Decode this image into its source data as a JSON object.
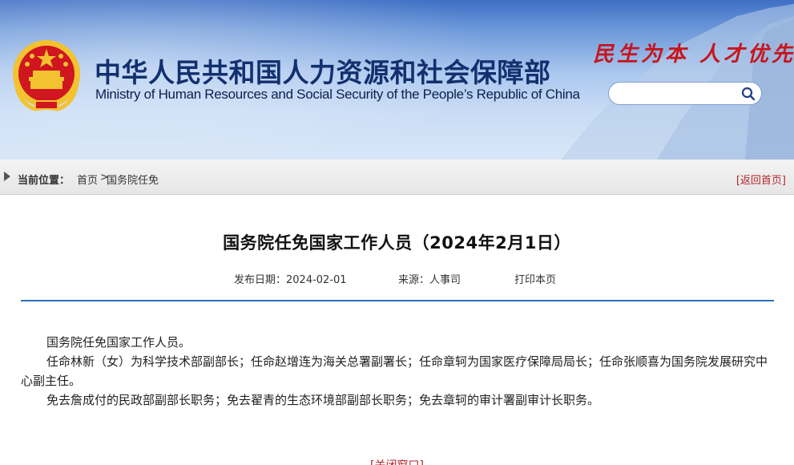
{
  "header": {
    "title_cn": "中华人民共和国人力资源和社会保障部",
    "title_en": "Ministry of Human Resources and Social Security of the People’s Republic of China",
    "slogan": "民生为本  人才优先",
    "search": {
      "value": "",
      "placeholder": ""
    }
  },
  "breadcrumb": {
    "label": "当前位置：",
    "home": "首页",
    "separator": ">",
    "current": "国务院任免",
    "back_home": "[返回首页]"
  },
  "article": {
    "title": "国务院任免国家工作人员（2024年2月1日）",
    "publish_date": "发布日期：2024-02-01",
    "source": "来源：人事司",
    "print": "打印本页",
    "paragraphs": [
      "国务院任免国家工作人员。",
      "任命林新（女）为科学技术部副部长；任命赵增连为海关总署副署长；任命章轲为国家医疗保障局局长；任命张顺喜为国务院发展研究中心副主任。",
      "免去詹成付的民政部副部长职务；免去翟青的生态环境部副部长职务；免去章轲的审计署副审计长职务。"
    ],
    "bottom_link": "[关闭窗口]"
  },
  "colors": {
    "header_blue": "#3e6fc4",
    "title_navy": "#12306e",
    "slogan_red": "#c8141b",
    "accent_red": "#b3262b",
    "divider_blue": "#2b6fb8",
    "emblem_gold": "#f2c230",
    "emblem_red": "#d0161e"
  },
  "icons": {
    "search": "search-icon",
    "emblem": "national-emblem-icon",
    "breadcrumb_marker": "triangle-right-icon"
  }
}
